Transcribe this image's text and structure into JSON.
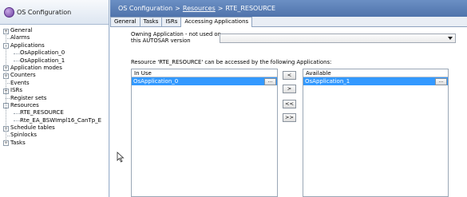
{
  "window": {
    "title": "OS Configuration"
  },
  "tree": {
    "items": [
      {
        "label": "General",
        "depth": 0,
        "expander": "+"
      },
      {
        "label": "Alarms",
        "depth": 0,
        "expander": ""
      },
      {
        "label": "Applications",
        "depth": 0,
        "expander": "-"
      },
      {
        "label": "OsApplication_0",
        "depth": 1,
        "expander": ""
      },
      {
        "label": "OsApplication_1",
        "depth": 1,
        "expander": ""
      },
      {
        "label": "Application modes",
        "depth": 0,
        "expander": "+"
      },
      {
        "label": "Counters",
        "depth": 0,
        "expander": "+"
      },
      {
        "label": "Events",
        "depth": 0,
        "expander": ""
      },
      {
        "label": "ISRs",
        "depth": 0,
        "expander": "+"
      },
      {
        "label": "Register sets",
        "depth": 0,
        "expander": ""
      },
      {
        "label": "Resources",
        "depth": 0,
        "expander": "-"
      },
      {
        "label": "RTE_RESOURCE",
        "depth": 1,
        "expander": ""
      },
      {
        "label": "Rte_EA_BSWImpl16_CanTp_E",
        "depth": 1,
        "expander": ""
      },
      {
        "label": "Schedule tables",
        "depth": 0,
        "expander": "+"
      },
      {
        "label": "Spinlocks",
        "depth": 0,
        "expander": ""
      },
      {
        "label": "Tasks",
        "depth": 0,
        "expander": "+"
      }
    ]
  },
  "breadcrumb": {
    "root": "OS Configuration",
    "separator": ">",
    "middle": "Resources",
    "current": "RTE_RESOURCE"
  },
  "tabs": [
    {
      "label": "General",
      "active": false
    },
    {
      "label": "Tasks",
      "active": false
    },
    {
      "label": "ISRs",
      "active": false
    },
    {
      "label": "Accessing Applications",
      "active": true
    }
  ],
  "owning": {
    "label_line1": "Owning Application - not used on",
    "label_line2": "this AUTOSAR version",
    "value": ""
  },
  "resource_caption": "Resource 'RTE_RESOURCE' can be accessed by the following Applications:",
  "in_use": {
    "header": "In Use",
    "rows": [
      "OsApplication_0"
    ],
    "ellipsis": "..."
  },
  "available": {
    "header": "Available",
    "rows": [
      "OsApplication_1"
    ],
    "ellipsis": "..."
  },
  "move_buttons": {
    "add_one": "<",
    "remove_one": ">",
    "add_all": "<<",
    "remove_all": ">>"
  },
  "colors": {
    "selection": "#3399ff",
    "breadcrumb_bg": "#5b7fb8"
  }
}
